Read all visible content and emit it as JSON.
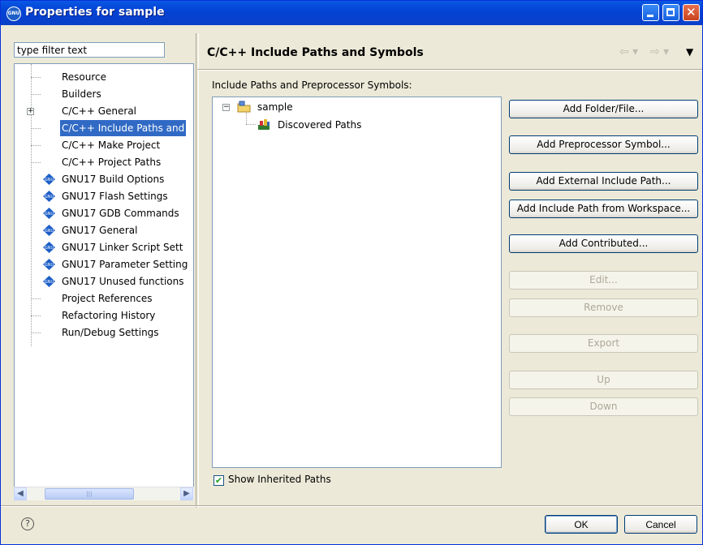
{
  "window": {
    "title": "Properties for sample",
    "app_icon_text": "GNU"
  },
  "filter": {
    "value": "type filter text"
  },
  "tree": {
    "items": [
      {
        "label": "Resource",
        "type": "leaf"
      },
      {
        "label": "Builders",
        "type": "leaf"
      },
      {
        "label": "C/C++ General",
        "type": "expandable",
        "expander": "+"
      },
      {
        "label": "C/C++ Include Paths and",
        "type": "leaf",
        "selected": true
      },
      {
        "label": "C/C++ Make Project",
        "type": "leaf"
      },
      {
        "label": "C/C++ Project Paths",
        "type": "leaf"
      },
      {
        "label": "GNU17 Build Options",
        "type": "gnu"
      },
      {
        "label": "GNU17 Flash Settings",
        "type": "gnu"
      },
      {
        "label": "GNU17 GDB Commands",
        "type": "gnu"
      },
      {
        "label": "GNU17 General",
        "type": "gnu"
      },
      {
        "label": "GNU17 Linker Script Sett",
        "type": "gnu"
      },
      {
        "label": "GNU17 Parameter Setting",
        "type": "gnu"
      },
      {
        "label": "GNU17 Unused functions",
        "type": "gnu"
      },
      {
        "label": "Project References",
        "type": "leaf"
      },
      {
        "label": "Refactoring History",
        "type": "leaf"
      },
      {
        "label": "Run/Debug Settings",
        "type": "leaf"
      }
    ]
  },
  "page": {
    "title": "C/C++ Include Paths and Symbols",
    "section_label": "Include Paths and Preprocessor Symbols:",
    "paths_tree": {
      "expander": "−",
      "root": "sample",
      "child": "Discovered Paths"
    },
    "buttons": [
      {
        "label": "Add Folder/File...",
        "enabled": true
      },
      {
        "label": "Add Preprocessor Symbol...",
        "enabled": true
      },
      {
        "label": "Add External Include Path...",
        "enabled": true
      },
      {
        "label": "Add Include Path from Workspace...",
        "enabled": true
      },
      {
        "label": "Add Contributed...",
        "enabled": true
      },
      {
        "label": "Edit...",
        "enabled": false
      },
      {
        "label": "Remove",
        "enabled": false
      },
      {
        "label": "Export",
        "enabled": false
      },
      {
        "label": "Up",
        "enabled": false
      },
      {
        "label": "Down",
        "enabled": false
      }
    ],
    "show_inherited": {
      "label": "Show Inherited Paths",
      "checked": true
    }
  },
  "dialog_buttons": {
    "ok": "OK",
    "cancel": "Cancel"
  },
  "colors": {
    "titlebar": "#0a58e5",
    "selection": "#316ac5",
    "dialog_bg": "#ece9d8"
  }
}
